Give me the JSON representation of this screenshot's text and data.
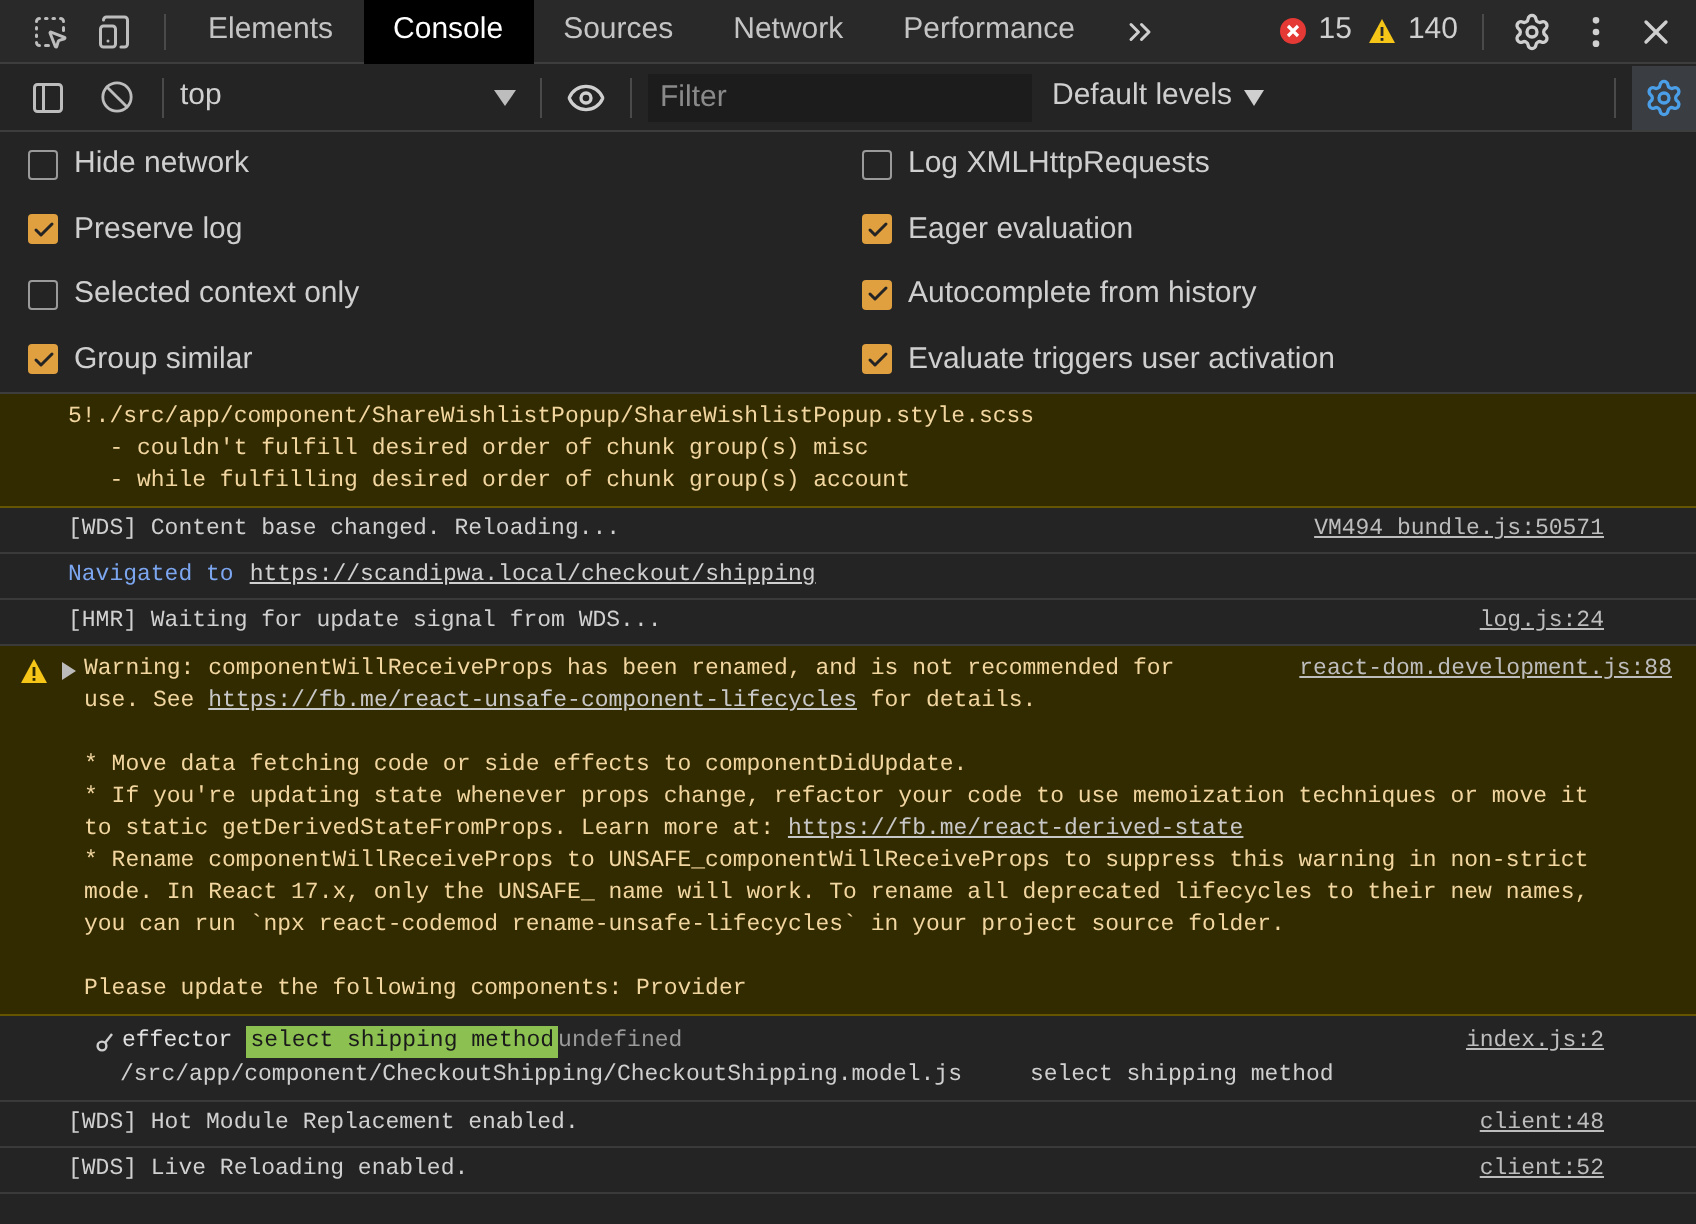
{
  "toolbar_tabs": [
    {
      "label": "Elements",
      "selected": false
    },
    {
      "label": "Console",
      "selected": true
    },
    {
      "label": "Sources",
      "selected": false
    },
    {
      "label": "Network",
      "selected": false
    },
    {
      "label": "Performance",
      "selected": false
    }
  ],
  "counters": {
    "errors": "15",
    "warnings": "140"
  },
  "console_toolbar": {
    "context": "top",
    "filter_placeholder": "Filter",
    "levels": "Default levels",
    "settings_open": true
  },
  "settings": [
    {
      "label": "Hide network",
      "checked": false
    },
    {
      "label": "Log XMLHttpRequests",
      "checked": false
    },
    {
      "label": "Preserve log",
      "checked": true
    },
    {
      "label": "Eager evaluation",
      "checked": true
    },
    {
      "label": "Selected context only",
      "checked": false
    },
    {
      "label": "Autocomplete from history",
      "checked": true
    },
    {
      "label": "Group similar",
      "checked": true
    },
    {
      "label": "Evaluate triggers user activation",
      "checked": true
    }
  ],
  "messages": [
    {
      "kind": "warning_tail",
      "lines": [
        [
          {
            "text": "5!./src/app/component/ShareWishlistPopup/ShareWishlistPopup.style.scss"
          }
        ],
        [
          {
            "text": "   - couldn't fulfill desired order of chunk group(s) misc"
          }
        ],
        [
          {
            "text": "   - while fulfilling desired order of chunk group(s) account"
          }
        ]
      ]
    },
    {
      "kind": "log",
      "lines": [
        [
          {
            "text": "[WDS] Content base changed. Reloading..."
          }
        ]
      ],
      "source": "VM494 bundle.js:50571"
    },
    {
      "kind": "navigation",
      "label": "Navigated to",
      "url": "https://scandipwa.local/checkout/shipping"
    },
    {
      "kind": "log",
      "lines": [
        [
          {
            "text": "[HMR] Waiting for update signal from WDS..."
          }
        ]
      ],
      "source": "log.js:24"
    },
    {
      "kind": "warning",
      "source": "react-dom.development.js:88",
      "paragraphs": [
        [
          [
            {
              "kind": "text",
              "text": "Warning: componentWillReceiveProps has been renamed, and is not recommended for"
            }
          ],
          [
            {
              "kind": "text",
              "text": "use. See "
            },
            {
              "kind": "link",
              "text": "https://fb.me/react-unsafe-component-lifecycles"
            },
            {
              "kind": "text",
              "text": " for details."
            }
          ]
        ],
        [
          [
            {
              "kind": "text",
              "text": "* Move data fetching code or side effects to componentDidUpdate."
            }
          ],
          [
            {
              "kind": "text",
              "text": "* If you're updating state whenever props change, refactor your code to use memoization techniques or move it"
            }
          ],
          [
            {
              "kind": "text",
              "text": "to static getDerivedStateFromProps. Learn more at: "
            },
            {
              "kind": "link",
              "text": "https://fb.me/react-derived-state"
            }
          ],
          [
            {
              "kind": "text",
              "text": "* Rename componentWillReceiveProps to UNSAFE_componentWillReceiveProps to suppress this warning in non-strict"
            }
          ],
          [
            {
              "kind": "text",
              "text": "mode. In React 17.x, only the UNSAFE_ name will work. To rename all deprecated lifecycles to their new names,"
            }
          ],
          [
            {
              "kind": "text",
              "text": "you can run `npx react-codemod rename-unsafe-lifecycles` in your project source folder."
            }
          ]
        ],
        [
          [
            {
              "kind": "text",
              "text": "Please update the following components: Provider"
            }
          ]
        ]
      ]
    },
    {
      "kind": "effector",
      "name": "effector",
      "badge": "select shipping method",
      "value": "undefined",
      "path": "/src/app/component/CheckoutShipping/CheckoutShipping.model.js",
      "event": "select shipping method",
      "source": "index.js:2"
    },
    {
      "kind": "log",
      "lines": [
        [
          {
            "text": "[WDS] Hot Module Replacement enabled."
          }
        ]
      ],
      "source": "client:48"
    },
    {
      "kind": "log",
      "lines": [
        [
          {
            "text": "[WDS] Live Reloading enabled."
          }
        ]
      ],
      "source": "client:52"
    }
  ]
}
